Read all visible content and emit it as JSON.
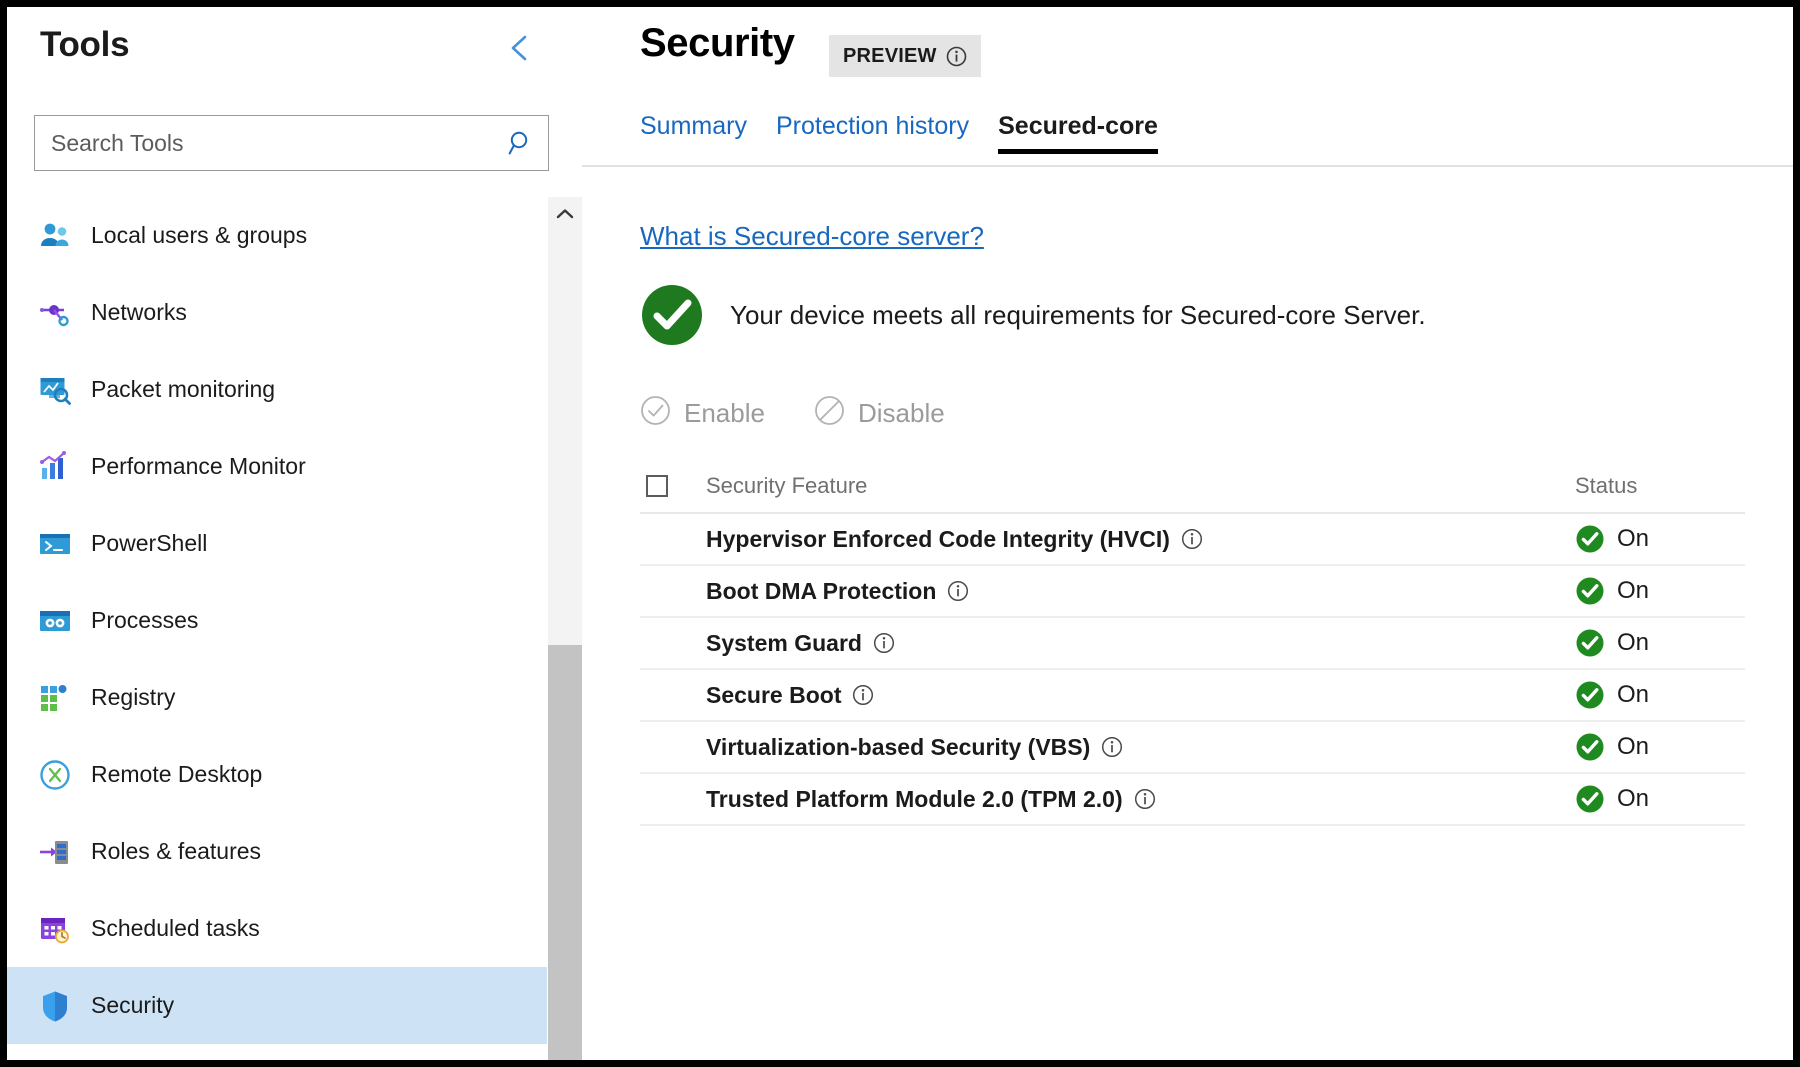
{
  "sidebar": {
    "title": "Tools",
    "collapse_icon": "chevron-left-icon",
    "search": {
      "placeholder": "Search Tools",
      "value": "",
      "icon": "search-icon"
    },
    "scrollbar": {
      "up_arrow_icon": "chevron-up-icon"
    },
    "items": [
      {
        "label": "Local users & groups",
        "icon": "users-group-icon",
        "selected": false
      },
      {
        "label": "Networks",
        "icon": "network-icon",
        "selected": false
      },
      {
        "label": "Packet monitoring",
        "icon": "packet-monitoring-icon",
        "selected": false
      },
      {
        "label": "Performance Monitor",
        "icon": "performance-monitor-icon",
        "selected": false
      },
      {
        "label": "PowerShell",
        "icon": "powershell-icon",
        "selected": false
      },
      {
        "label": "Processes",
        "icon": "processes-icon",
        "selected": false
      },
      {
        "label": "Registry",
        "icon": "registry-icon",
        "selected": false
      },
      {
        "label": "Remote Desktop",
        "icon": "remote-desktop-icon",
        "selected": false
      },
      {
        "label": "Roles & features",
        "icon": "roles-features-icon",
        "selected": false
      },
      {
        "label": "Scheduled tasks",
        "icon": "scheduled-tasks-icon",
        "selected": false
      },
      {
        "label": "Security",
        "icon": "shield-icon",
        "selected": true
      }
    ]
  },
  "main": {
    "title": "Security",
    "badge": {
      "label": "PREVIEW",
      "icon": "info-icon"
    },
    "tabs": [
      {
        "label": "Summary",
        "active": false
      },
      {
        "label": "Protection history",
        "active": false
      },
      {
        "label": "Secured-core",
        "active": true
      }
    ],
    "link": {
      "label": "What is Secured-core server?"
    },
    "status_banner": {
      "icon": "check-circle-icon",
      "message": "Your device meets all requirements for Secured-core Server."
    },
    "commands": [
      {
        "label": "Enable",
        "icon": "check-circle-outline-icon",
        "disabled": true
      },
      {
        "label": "Disable",
        "icon": "block-circle-icon",
        "disabled": true
      }
    ],
    "table": {
      "headers": {
        "select_all": "",
        "feature": "Security Feature",
        "status": "Status"
      },
      "rows": [
        {
          "feature": "Hypervisor Enforced Code Integrity (HVCI)",
          "info_icon": "info-icon",
          "status": "On",
          "status_icon": "check-circle-icon"
        },
        {
          "feature": "Boot DMA Protection",
          "info_icon": "info-icon",
          "status": "On",
          "status_icon": "check-circle-icon"
        },
        {
          "feature": "System Guard",
          "info_icon": "info-icon",
          "status": "On",
          "status_icon": "check-circle-icon"
        },
        {
          "feature": "Secure Boot",
          "info_icon": "info-icon",
          "status": "On",
          "status_icon": "check-circle-icon"
        },
        {
          "feature": "Virtualization-based Security (VBS)",
          "info_icon": "info-icon",
          "status": "On",
          "status_icon": "check-circle-icon"
        },
        {
          "feature": "Trusted Platform Module 2.0 (TPM 2.0)",
          "info_icon": "info-icon",
          "status": "On",
          "status_icon": "check-circle-icon"
        }
      ]
    }
  },
  "colors": {
    "accent_link": "#1868c0",
    "success_green": "#1f7a1f",
    "selected_row": "#cde3f5",
    "disabled_text": "#9b9b9b",
    "header_text": "#707070",
    "badge_bg": "#e4e4e4"
  }
}
